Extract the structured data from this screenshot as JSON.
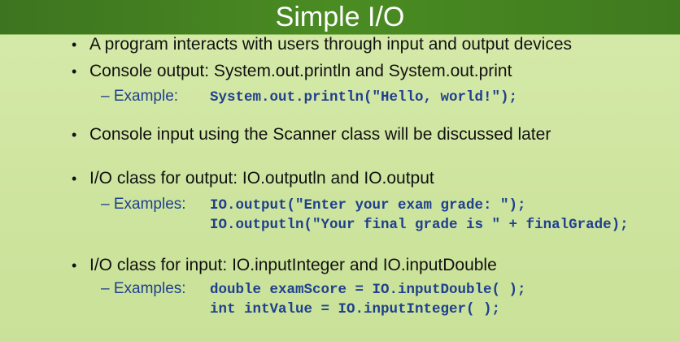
{
  "slide": {
    "title": "Simple I/O",
    "bullets": [
      {
        "text": "A program interacts with users through input and output devices"
      },
      {
        "text": "Console output: System.out.println and System.out.print",
        "sub_label": "– Example:",
        "code": [
          "System.out.println(\"Hello, world!\");"
        ]
      },
      {
        "text": "Console input using the Scanner class will be discussed later"
      },
      {
        "text": "I/O class for output: IO.outputln and IO.output",
        "sub_label": "– Examples:",
        "code": [
          "IO.output(\"Enter your exam grade: \");",
          "IO.outputln(\"Your final grade is \" + finalGrade);"
        ]
      },
      {
        "text": "I/O class for input: IO.inputInteger and IO.inputDouble",
        "sub_label": "– Examples:",
        "code": [
          "double examScore = IO.inputDouble( );",
          "int intValue = IO.inputInteger( );"
        ]
      }
    ],
    "bullet_symbol": "•",
    "colors": {
      "header": "#4a8c22",
      "background": "#d0e6a2",
      "code": "#1f3f8f"
    }
  }
}
